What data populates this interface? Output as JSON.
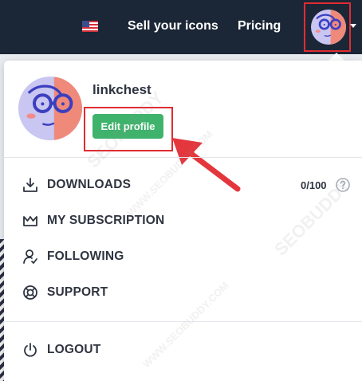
{
  "header": {
    "locale_icon": "us-flag-icon",
    "sell_label": "Sell your icons",
    "pricing_label": "Pricing",
    "avatar_icon": "user-avatar-icon",
    "menu_caret_icon": "chevron-down-icon"
  },
  "profile": {
    "username": "linkchest",
    "edit_label": "Edit profile"
  },
  "menu": {
    "downloads": {
      "label": "DOWNLOADS",
      "icon": "download-icon",
      "count": "0/100",
      "help_icon": "question-circle-icon"
    },
    "subscription": {
      "label": "MY SUBSCRIPTION",
      "icon": "crown-icon"
    },
    "following": {
      "label": "FOLLOWING",
      "icon": "user-follow-icon"
    },
    "support": {
      "label": "SUPPORT",
      "icon": "lifebuoy-icon"
    },
    "logout": {
      "label": "LOGOUT",
      "icon": "power-icon"
    }
  },
  "watermarks": [
    "SEOBUDDY",
    "WWW.SEOBUDDY.COM",
    "SEOBUDDY",
    "WWW.SEOBUDDY.COM"
  ],
  "colors": {
    "header_bg": "#1b2636",
    "edit_button": "#3fb36c",
    "highlight": "#e02c32",
    "text": "#2e3440"
  }
}
